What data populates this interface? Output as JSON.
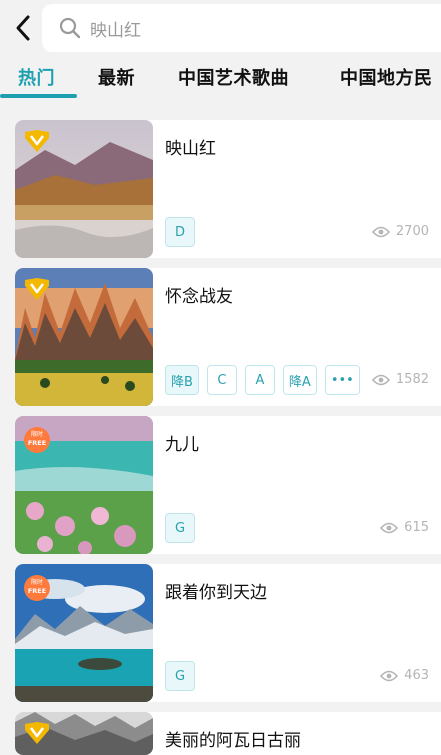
{
  "search": {
    "query": "映山红"
  },
  "tabs": [
    {
      "label": "热门"
    },
    {
      "label": "最新"
    },
    {
      "label": "中国艺术歌曲"
    },
    {
      "label": "中国地方民"
    }
  ],
  "songs": [
    {
      "title": "映山红",
      "badge": "v-badge",
      "keys": [
        "D"
      ],
      "views": "2700"
    },
    {
      "title": "怀念战友",
      "badge": "v-badge",
      "keys": [
        "降B",
        "C",
        "A",
        "降A",
        "•••"
      ],
      "views": "1582"
    },
    {
      "title": "九儿",
      "badge": "free-badge",
      "badge_text": "FREE",
      "badge_top": "限时",
      "keys": [
        "G"
      ],
      "views": "615"
    },
    {
      "title": "跟着你到天边",
      "badge": "free-badge",
      "badge_text": "FREE",
      "badge_top": "限时",
      "keys": [
        "G"
      ],
      "views": "463"
    },
    {
      "title": "美丽的阿瓦日古丽",
      "badge": "v-badge",
      "keys": [],
      "views": ""
    }
  ],
  "colors": {
    "accent": "#1ea0b0",
    "badge_gold": "#f5b800",
    "badge_free": "#ff7a3d"
  }
}
